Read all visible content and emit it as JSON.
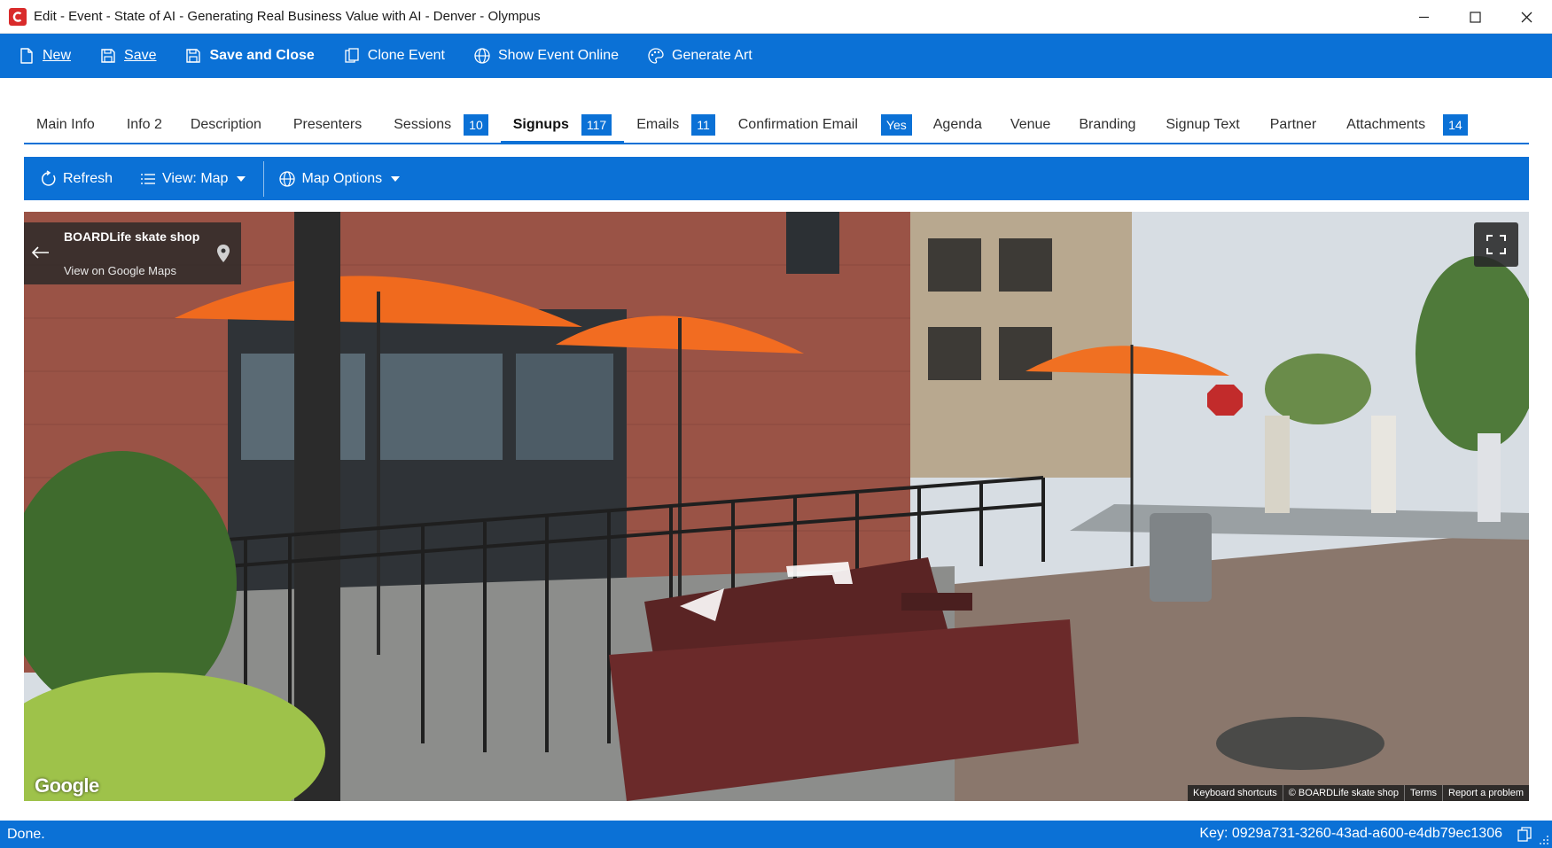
{
  "window": {
    "title": "Edit - Event - State of AI - Generating Real Business Value with AI - Denver - Olympus",
    "logo_icon": "app-logo-icon",
    "controls": [
      "minimize-icon",
      "maximize-icon",
      "close-icon"
    ]
  },
  "ribbon": {
    "color": "#0b71d6",
    "new_label": "New",
    "save_label": "Save",
    "save_close_label": "Save and Close",
    "clone_label": "Clone Event",
    "show_online_label": "Show Event Online",
    "generate_art_label": "Generate Art"
  },
  "tabs": [
    {
      "label": "Main Info"
    },
    {
      "label": "Info 2"
    },
    {
      "label": "Description"
    },
    {
      "label": "Presenters"
    },
    {
      "label": "Sessions",
      "badge": "10"
    },
    {
      "label": "Signups",
      "badge": "117",
      "active": true
    },
    {
      "label": "Emails",
      "badge": "11"
    },
    {
      "label": "Confirmation Email",
      "badge": "Yes"
    },
    {
      "label": "Agenda"
    },
    {
      "label": "Venue"
    },
    {
      "label": "Branding"
    },
    {
      "label": "Signup Text"
    },
    {
      "label": "Partner"
    },
    {
      "label": "Attachments",
      "badge": "14"
    }
  ],
  "map_toolbar": {
    "refresh_label": "Refresh",
    "view_label": "View: Map",
    "map_options_label": "Map Options"
  },
  "street_view": {
    "place_name": "BOARDLife skate shop",
    "place_link": "View on Google Maps",
    "google_logo": "Google",
    "attribution": {
      "shortcuts": "Keyboard shortcuts",
      "copyright": "© BOARDLife skate shop",
      "terms": "Terms",
      "report": "Report a problem"
    }
  },
  "status": {
    "left": "Done.",
    "right": "Key: 0929a731-3260-43ad-a600-e4db79ec1306"
  }
}
